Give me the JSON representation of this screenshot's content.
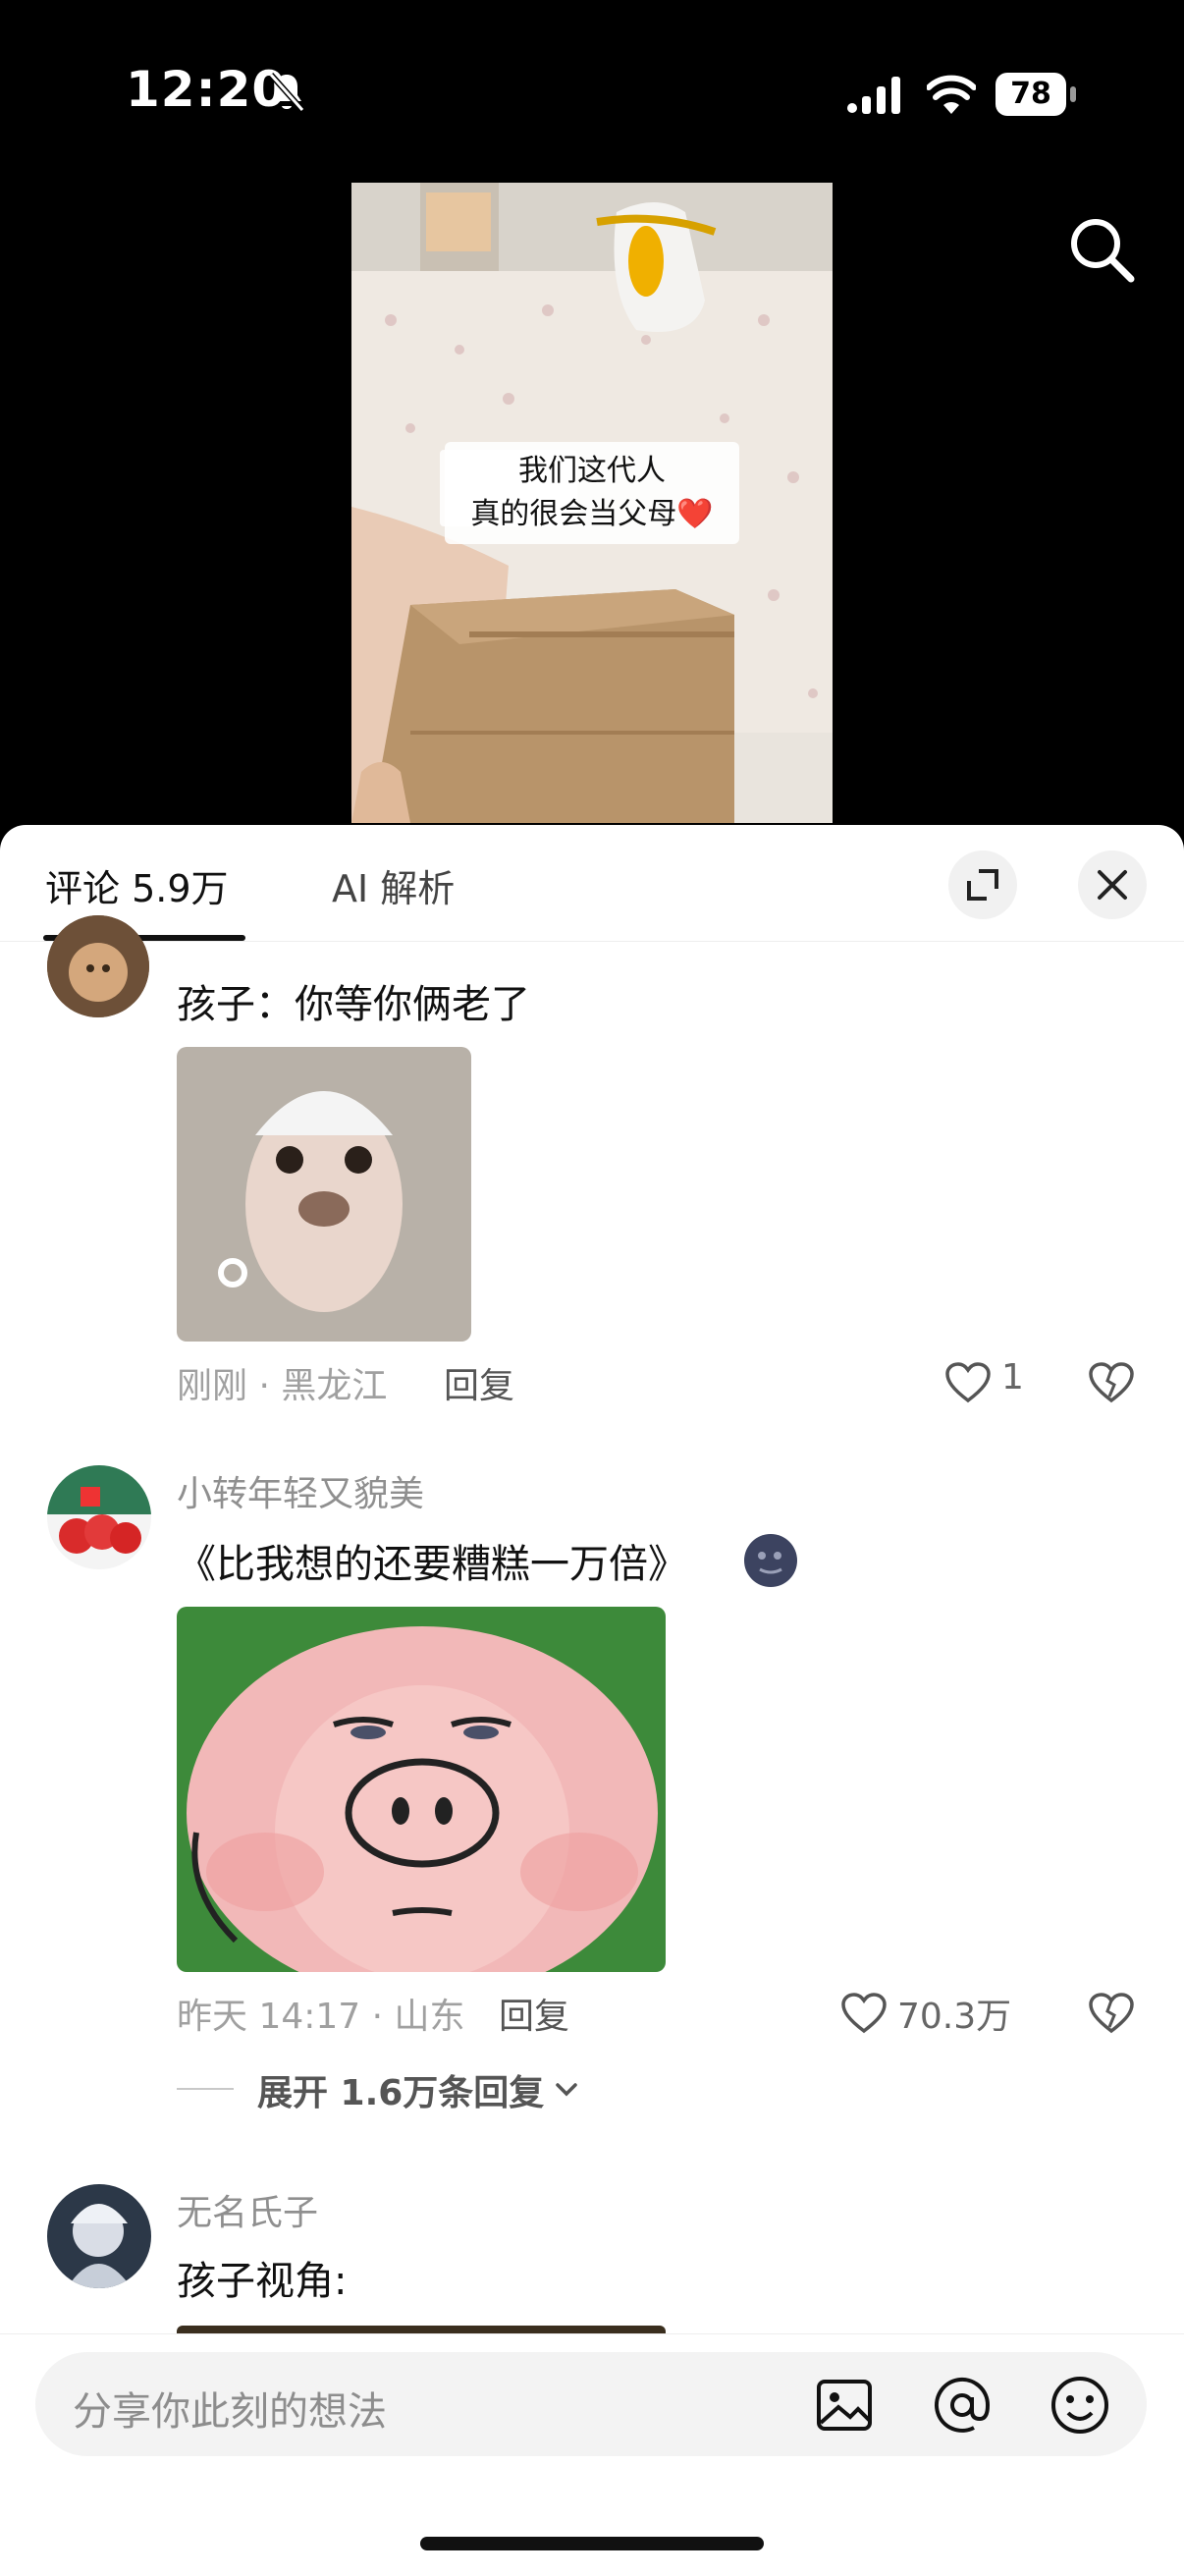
{
  "status": {
    "time": "12:20",
    "battery": "78"
  },
  "video": {
    "caption_line1": "我们这代人",
    "caption_line2": "真的很会当父母❤️"
  },
  "tabs": {
    "comments": "评论 5.9万",
    "ai": "AI 解析"
  },
  "comments": [
    {
      "text": "孩子：你等你俩老了",
      "meta": "刚刚 · 黑龙江",
      "reply": "回复",
      "likes": "1"
    },
    {
      "user": "小转年轻又貌美",
      "text": "《比我想的还要糟糕一万倍》",
      "meta": "昨天 14:17 · 山东",
      "reply": "回复",
      "likes": "70.3万",
      "expand": "展开 1.6万条回复"
    },
    {
      "user": "无名氏子",
      "text": "孩子视角:"
    }
  ],
  "input": {
    "placeholder": "分享你此刻的想法"
  },
  "icons": [
    "bell-slash-icon",
    "signal-icon",
    "wifi-icon",
    "battery-icon",
    "search-icon",
    "expand-icon",
    "close-icon",
    "heart-icon",
    "broken-heart-icon",
    "chevron-down-icon",
    "image-icon",
    "at-icon",
    "emoji-icon"
  ]
}
